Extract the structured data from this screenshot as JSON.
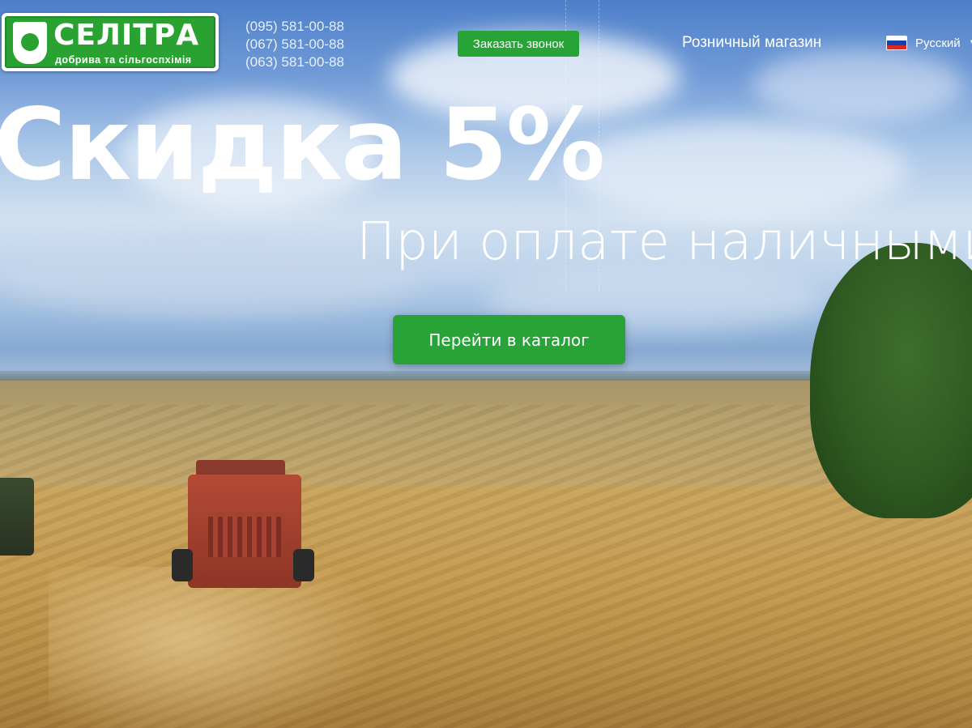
{
  "brand": {
    "name": "СЕЛІТРА",
    "tagline": "добрива та сільгоспхімія"
  },
  "contacts": {
    "phones": [
      "(095) 581-00-88",
      "(067) 581-00-88",
      "(063) 581-00-88"
    ]
  },
  "header": {
    "call_button": "Заказать звонок",
    "retail_link": "Розничный магазин",
    "language": "Русский",
    "language_flag": "russia-flag-icon"
  },
  "hero": {
    "headline": "Скидка 5%",
    "subheadline": "При оплате наличными",
    "cta_label": "Перейти в каталог"
  },
  "colors": {
    "accent_green": "#27a338",
    "text": "#ffffff"
  }
}
